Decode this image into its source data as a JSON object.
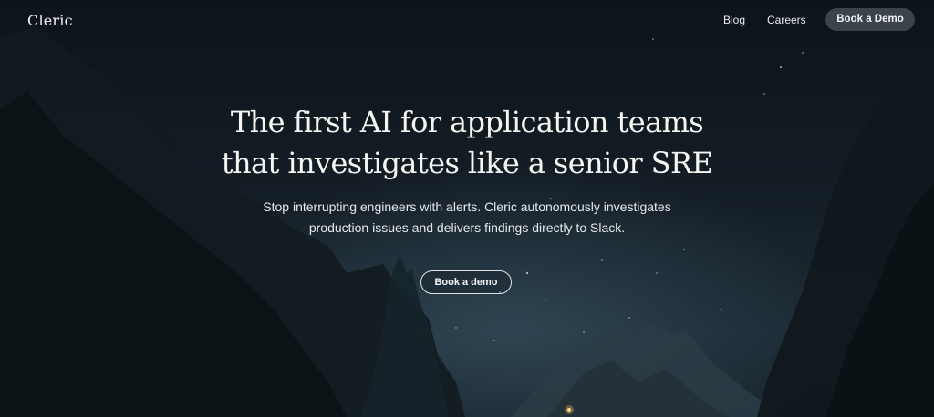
{
  "nav": {
    "logo": "Cleric",
    "links": [
      "Blog",
      "Careers"
    ],
    "cta_label": "Book a Demo"
  },
  "hero": {
    "title_line1": "The first AI for application teams",
    "title_line2": "that investigates like a senior SRE",
    "subtitle_line1": "Stop interrupting engineers with alerts. Cleric autonomously investigates",
    "subtitle_line2": "production issues and delivers findings directly to Slack.",
    "cta_label": "Book a demo"
  },
  "colors": {
    "background": "#0f151c",
    "nav_button": "#3b434b",
    "text": "#f5f5f2"
  }
}
